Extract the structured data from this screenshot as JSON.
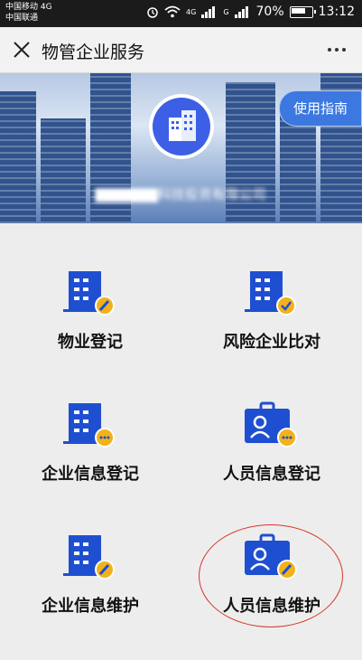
{
  "status_bar": {
    "carrier_line1": "中国移动 4G",
    "carrier_line2": "中国联通",
    "network_badge1": "4G",
    "network_badge2": "G",
    "battery": "70%",
    "time": "13:12"
  },
  "header": {
    "title": "物管企业服务"
  },
  "banner": {
    "guide_label": "使用指南",
    "company_name": "▇▇▇▇▇▇科技投资有限公司"
  },
  "services": [
    {
      "label": "物业登记"
    },
    {
      "label": "风险企业比对"
    },
    {
      "label": "企业信息登记"
    },
    {
      "label": "人员信息登记"
    },
    {
      "label": "企业信息维护"
    },
    {
      "label": "人员信息维护"
    }
  ],
  "colors": {
    "icon_blue": "#1f4fd1",
    "icon_badge": "#f2b21b",
    "guide_blue": "#3c78e0",
    "annotation_red": "#d9352e"
  }
}
